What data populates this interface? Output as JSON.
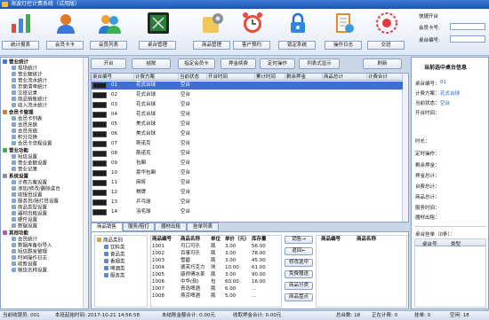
{
  "window": {
    "title": "海波灯控计费系统（试用版）"
  },
  "toolbar": [
    {
      "label": "统计报表",
      "icon": "bar-chart-icon"
    },
    {
      "label": "会员卡卡",
      "icon": "member-card-icon"
    },
    {
      "label": "会员列表",
      "icon": "member-list-icon"
    },
    {
      "label": "桌台管理",
      "icon": "billiard-table-icon"
    },
    {
      "label": "商品管理",
      "icon": "goods-settings-icon"
    },
    {
      "label": "客户预约",
      "icon": "alarm-clock-icon"
    },
    {
      "label": "锁定系统",
      "icon": "lock-icon"
    },
    {
      "label": "操作日志",
      "icon": "log-icon"
    },
    {
      "label": "交班",
      "icon": "handover-icon"
    }
  ],
  "login": {
    "title": "快捷开台",
    "card_label": "会员卡号:",
    "table_label": "桌台编号:"
  },
  "sidebar": {
    "groups": [
      {
        "label": "营业统计",
        "items": [
          "现场统计",
          "营业额统计",
          "营业流水统计",
          "页面清单统计",
          "交班记录",
          "商品销售统计",
          "收入流水统计"
        ]
      },
      {
        "label": "会员卡管理",
        "items": [
          "会员卡列表",
          "会员充值",
          "会员充值",
          "积分兑换",
          "会员卡流程设置"
        ]
      },
      {
        "label": "营业功能",
        "items": [
          "短信设置",
          "营业金额设置",
          "营业记录"
        ]
      },
      {
        "label": "系统设置",
        "items": [
          "计费方案设置",
          "添加/修改/删除桌台",
          "收银员设置",
          "服务员/陪打员设置",
          "商品类型设置",
          "器材出租设置",
          "硬件设置",
          "数据设置"
        ]
      },
      {
        "label": "其他功能",
        "items": [
          "会员统计",
          "数据库备份导入",
          "短信群发管理",
          "时间操作日志",
          "收款设置",
          "微信名称设置"
        ]
      }
    ]
  },
  "actions": [
    "开台",
    "结账",
    "指定会员卡",
    "押金续费",
    "定时操作",
    "列表式显示",
    "刷新"
  ],
  "grid": {
    "headers": [
      "桌台编号",
      "计费方案",
      "当前状态",
      "开台时间",
      "累计时间",
      "剩余押金",
      "商品总计",
      "计费合计"
    ],
    "rows": [
      {
        "id": "01",
        "plan": "花式台球",
        "status": "空台"
      },
      {
        "id": "02",
        "plan": "花式台球",
        "status": "空台"
      },
      {
        "id": "03",
        "plan": "花式台球",
        "status": "空台"
      },
      {
        "id": "04",
        "plan": "花式台球",
        "status": "空台"
      },
      {
        "id": "05",
        "plan": "美式台球",
        "status": "空台"
      },
      {
        "id": "06",
        "plan": "美式台球",
        "status": "空台"
      },
      {
        "id": "07",
        "plan": "斯诺克",
        "status": "空台"
      },
      {
        "id": "08",
        "plan": "斯诺克",
        "status": "空台"
      },
      {
        "id": "09",
        "plan": "包厢",
        "status": "空台"
      },
      {
        "id": "10",
        "plan": "豪华包厢",
        "status": "空台"
      },
      {
        "id": "11",
        "plan": "麻将",
        "status": "空台"
      },
      {
        "id": "12",
        "plan": "棋牌",
        "status": "空台"
      },
      {
        "id": "13",
        "plan": "乒乓球",
        "status": "空台"
      },
      {
        "id": "14",
        "plan": "羽毛球",
        "status": "空台"
      }
    ]
  },
  "tabs": [
    "商品销售",
    "服务/陪打",
    "器材出租",
    "挂单列表"
  ],
  "goods": {
    "category_header": "商品类别",
    "categories": [
      "饮料类",
      "食品类",
      "香烟类",
      "啤酒类",
      "服务类"
    ],
    "headers": [
      "商品编号",
      "商品名称",
      "单位",
      "单价（元）",
      "库存量"
    ],
    "rows": [
      {
        "code": "1001",
        "name": "可口可乐",
        "unit": "瓶",
        "price": "3.00",
        "stock": "56.00"
      },
      {
        "code": "1002",
        "name": "百事可乐",
        "unit": "瓶",
        "price": "3.00",
        "stock": "78.00"
      },
      {
        "code": "1003",
        "name": "雪碧",
        "unit": "瓶",
        "price": "3.00",
        "stock": "45.00"
      },
      {
        "code": "1004",
        "name": "德芙巧克力",
        "unit": "块",
        "price": "10.00",
        "stock": "61.00"
      },
      {
        "code": "1005",
        "name": "康师傅冰茶",
        "unit": "瓶",
        "price": "3.00",
        "stock": "90.00"
      },
      {
        "code": "1006",
        "name": "中华(软)",
        "unit": "包",
        "price": "60.00",
        "stock": "16.00"
      },
      {
        "code": "1007",
        "name": "青岛啤酒",
        "unit": "瓶",
        "price": "6.00",
        "stock": "..."
      },
      {
        "code": "1008",
        "name": "燕京啤酒",
        "unit": "瓶",
        "price": "5.00",
        "stock": "..."
      }
    ],
    "buttons": [
      "销售→",
      "退回←",
      "修改选中",
      "免费赠送",
      "商品分类",
      "商品盘点"
    ],
    "sold_headers": [
      "商品编号",
      "商品名称"
    ]
  },
  "right_panel": {
    "title": "当前选中桌台信息",
    "fields": [
      {
        "label": "桌台编号：",
        "value": "01"
      },
      {
        "label": "计费方案：",
        "value": "花式台球"
      },
      {
        "label": "当前状态：",
        "value": "空台"
      },
      {
        "label": "开台时间：",
        "value": ""
      },
      {
        "label": "时长：",
        "value": ""
      },
      {
        "label": "定时操作：",
        "value": ""
      },
      {
        "label": "剩余押金：",
        "value": ""
      },
      {
        "label": "押金总计：",
        "value": ""
      },
      {
        "label": "台费总计：",
        "value": ""
      },
      {
        "label": "商品总计：",
        "value": ""
      },
      {
        "label": "服务时间：",
        "value": ""
      },
      {
        "label": "器材出租：",
        "value": ""
      }
    ],
    "list_title": "桌台挂单（0条）：",
    "list_headers": [
      "桌台号",
      "类型"
    ]
  },
  "status": {
    "operator": "当前收银员: 001",
    "start_time": "本班起始时间: 2017-10-21 14:56:58",
    "unsettled": "未结账金额合计: 0.00元",
    "collected": "收取押金合计: 0.00元",
    "total": "总台数: 18",
    "busy": "正在计费: 0",
    "pending": "挂单: 0",
    "free": "空闲: 18"
  },
  "colors": {
    "accent": "#1d54b3",
    "selected_row": "#3f6fd1",
    "link": "#1a5fd0"
  }
}
